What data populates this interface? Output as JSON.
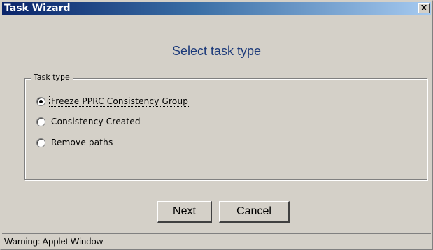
{
  "window": {
    "title": "Task Wizard",
    "close_glyph": "X"
  },
  "heading": "Select task type",
  "group": {
    "title": "Task type",
    "options": [
      {
        "label": "Freeze PPRC Consistency Group",
        "selected": true
      },
      {
        "label": "Consistency Created",
        "selected": false
      },
      {
        "label": "Remove paths",
        "selected": false
      }
    ]
  },
  "buttons": {
    "next_label": "Next",
    "cancel_label": "Cancel"
  },
  "status": "Warning: Applet Window",
  "colors": {
    "titlebar_start": "#0a246a",
    "titlebar_end": "#a6caf0",
    "heading": "#1c3a7a",
    "panel": "#d4d0c8"
  }
}
